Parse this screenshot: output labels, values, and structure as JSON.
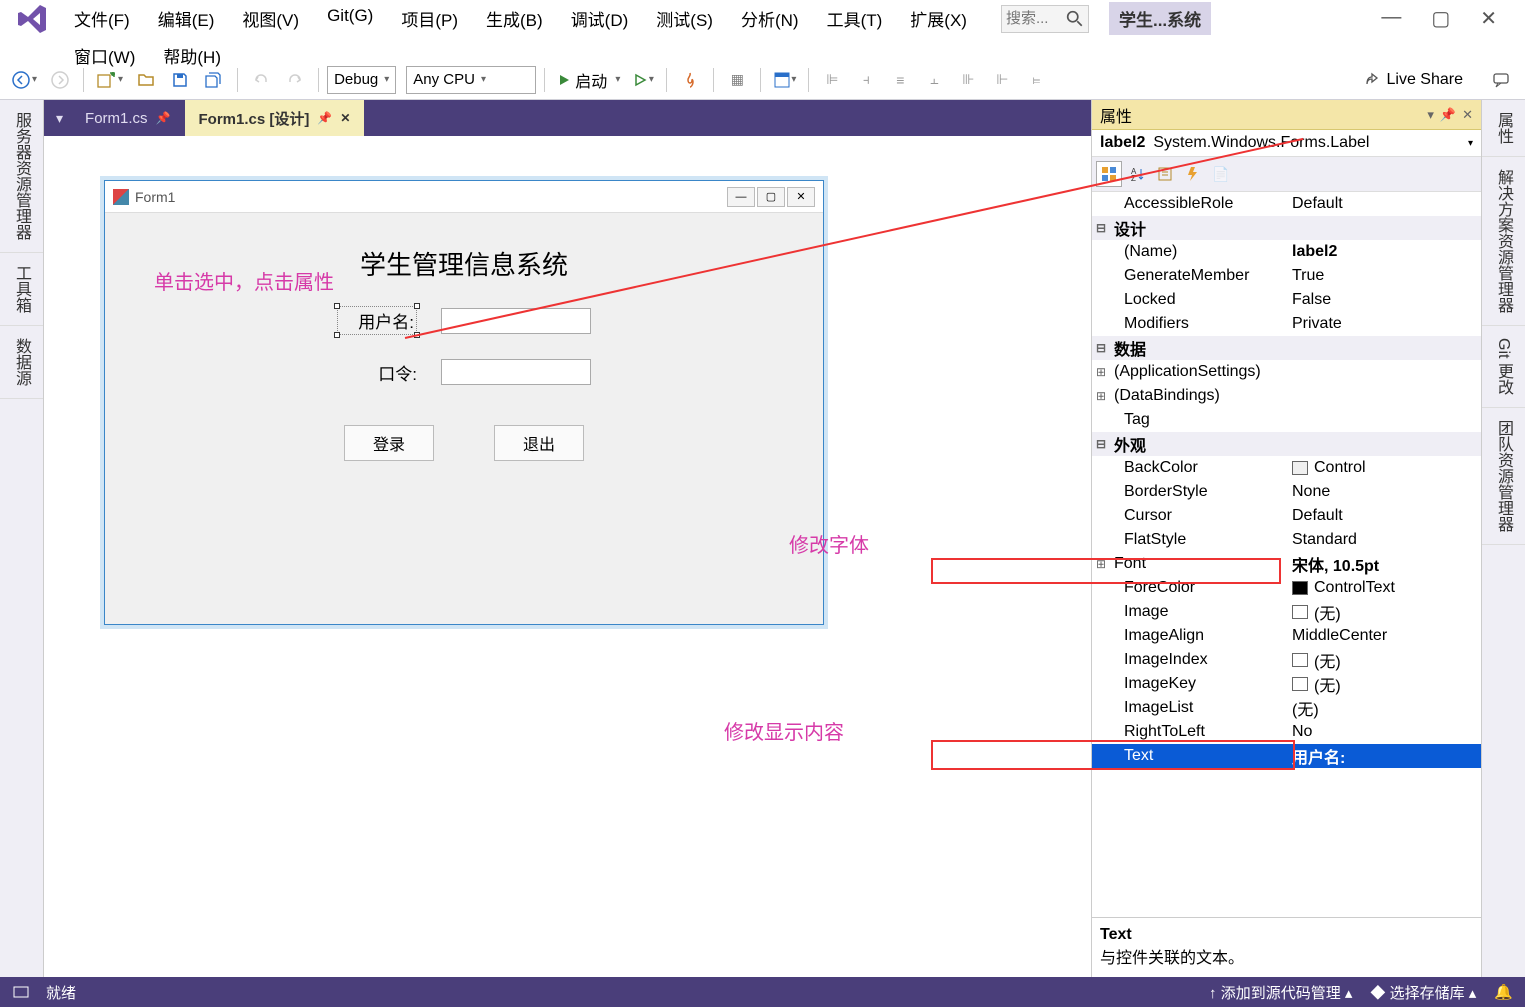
{
  "menu": {
    "items": [
      "文件(F)",
      "编辑(E)",
      "视图(V)",
      "Git(G)",
      "项目(P)",
      "生成(B)",
      "调试(D)",
      "测试(S)",
      "分析(N)",
      "工具(T)",
      "扩展(X)"
    ],
    "items2": [
      "窗口(W)",
      "帮助(H)"
    ],
    "search_placeholder": "搜索...",
    "title_badge": "学生...系统"
  },
  "toolbar": {
    "config": "Debug",
    "platform": "Any CPU",
    "start": "启动",
    "live_share": "Live Share"
  },
  "left_rail": [
    "服务器资源管理器",
    "工具箱",
    "数据源"
  ],
  "right_rail": [
    "属性",
    "解决方案资源管理器",
    "Git 更改",
    "团队资源管理器"
  ],
  "tabs": [
    {
      "label": "Form1.cs",
      "active": false,
      "pinned": true
    },
    {
      "label": "Form1.cs [设计]",
      "active": true,
      "pinned": true
    }
  ],
  "form": {
    "title": "Form1",
    "heading": "学生管理信息系统",
    "label_user": "用户名:",
    "label_pass": "口令:",
    "btn_login": "登录",
    "btn_exit": "退出"
  },
  "annotations": {
    "select_hint": "单击选中，点击属性",
    "font_hint": "修改字体",
    "text_hint": "修改显示内容"
  },
  "props": {
    "title": "属性",
    "object_name": "label2",
    "object_type": "System.Windows.Forms.Label",
    "rows": [
      {
        "type": "prop",
        "indent": true,
        "name": "AccessibleRole",
        "value": "Default"
      },
      {
        "type": "cat",
        "exp": "⊟",
        "name": "设计"
      },
      {
        "type": "prop",
        "indent": true,
        "name": "(Name)",
        "value": "label2",
        "bold": true
      },
      {
        "type": "prop",
        "indent": true,
        "name": "GenerateMember",
        "value": "True"
      },
      {
        "type": "prop",
        "indent": true,
        "name": "Locked",
        "value": "False"
      },
      {
        "type": "prop",
        "indent": true,
        "name": "Modifiers",
        "value": "Private"
      },
      {
        "type": "cat",
        "exp": "⊟",
        "name": "数据"
      },
      {
        "type": "prop",
        "exp": "⊞",
        "name": "(ApplicationSettings)",
        "value": ""
      },
      {
        "type": "prop",
        "exp": "⊞",
        "name": "(DataBindings)",
        "value": ""
      },
      {
        "type": "prop",
        "indent": true,
        "name": "Tag",
        "value": ""
      },
      {
        "type": "cat",
        "exp": "⊟",
        "name": "外观"
      },
      {
        "type": "prop",
        "indent": true,
        "name": "BackColor",
        "value": "Control",
        "swatch": "control"
      },
      {
        "type": "prop",
        "indent": true,
        "name": "BorderStyle",
        "value": "None"
      },
      {
        "type": "prop",
        "indent": true,
        "name": "Cursor",
        "value": "Default"
      },
      {
        "type": "prop",
        "indent": true,
        "name": "FlatStyle",
        "value": "Standard"
      },
      {
        "type": "prop",
        "exp": "⊞",
        "name": "Font",
        "value": "宋体, 10.5pt",
        "bold": true,
        "highlight": "font"
      },
      {
        "type": "prop",
        "indent": true,
        "name": "ForeColor",
        "value": "ControlText",
        "swatch": "ctext"
      },
      {
        "type": "prop",
        "indent": true,
        "name": "Image",
        "value": "(无)",
        "swatch": "empty"
      },
      {
        "type": "prop",
        "indent": true,
        "name": "ImageAlign",
        "value": "MiddleCenter"
      },
      {
        "type": "prop",
        "indent": true,
        "name": "ImageIndex",
        "value": "(无)",
        "swatch": "empty"
      },
      {
        "type": "prop",
        "indent": true,
        "name": "ImageKey",
        "value": "(无)",
        "swatch": "empty"
      },
      {
        "type": "prop",
        "indent": true,
        "name": "ImageList",
        "value": "(无)"
      },
      {
        "type": "prop",
        "indent": true,
        "name": "RightToLeft",
        "value": "No"
      },
      {
        "type": "prop",
        "indent": true,
        "name": "Text",
        "value": "用户名:",
        "bold": true,
        "selected": true,
        "highlight": "text"
      }
    ],
    "desc_title": "Text",
    "desc_body": "与控件关联的文本。"
  },
  "status": {
    "ready": "就绪",
    "source_control": "添加到源代码管理",
    "repo": "选择存储库"
  }
}
